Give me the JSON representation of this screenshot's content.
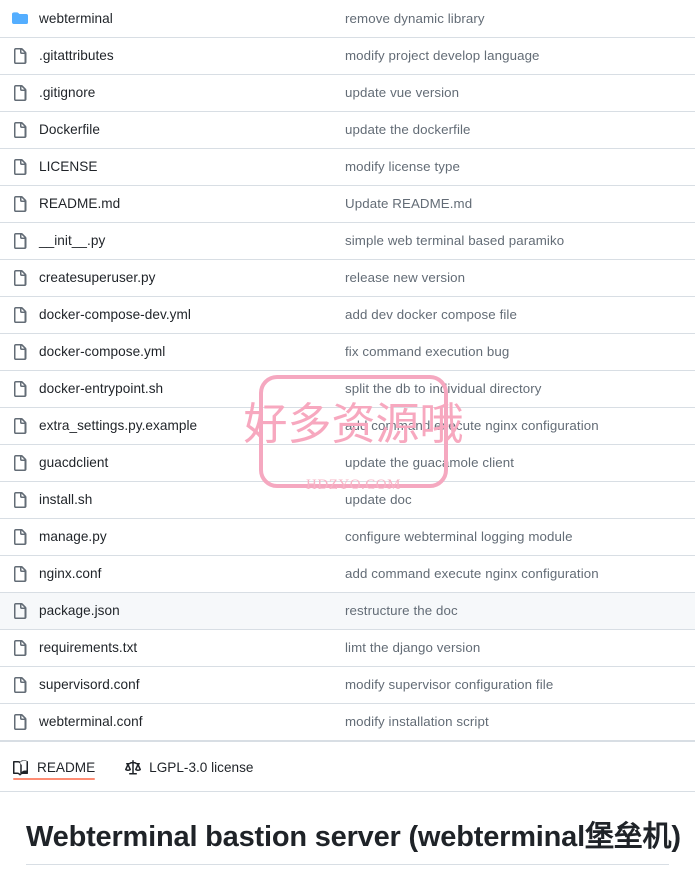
{
  "file_list": {
    "columns": [
      "name",
      "commit_message"
    ],
    "rows": [
      {
        "name": "webterminal",
        "icon": "folder-icon",
        "type": "folder",
        "commit_message": "remove dynamic library",
        "highlighted": false
      },
      {
        "name": ".gitattributes",
        "icon": "file-icon",
        "type": "file",
        "commit_message": "modify project develop language",
        "highlighted": false
      },
      {
        "name": ".gitignore",
        "icon": "file-icon",
        "type": "file",
        "commit_message": "update vue version",
        "highlighted": false
      },
      {
        "name": "Dockerfile",
        "icon": "file-icon",
        "type": "file",
        "commit_message": "update the dockerfile",
        "highlighted": false
      },
      {
        "name": "LICENSE",
        "icon": "file-icon",
        "type": "file",
        "commit_message": "modify license type",
        "highlighted": false
      },
      {
        "name": "README.md",
        "icon": "file-icon",
        "type": "file",
        "commit_message": "Update README.md",
        "highlighted": false
      },
      {
        "name": "__init__.py",
        "icon": "file-icon",
        "type": "file",
        "commit_message": "simple web terminal based paramiko",
        "highlighted": false
      },
      {
        "name": "createsuperuser.py",
        "icon": "file-icon",
        "type": "file",
        "commit_message": "release new version",
        "highlighted": false
      },
      {
        "name": "docker-compose-dev.yml",
        "icon": "file-icon",
        "type": "file",
        "commit_message": "add dev docker compose file",
        "highlighted": false
      },
      {
        "name": "docker-compose.yml",
        "icon": "file-icon",
        "type": "file",
        "commit_message": "fix command execution bug",
        "highlighted": false
      },
      {
        "name": "docker-entrypoint.sh",
        "icon": "file-icon",
        "type": "file",
        "commit_message": "split the db to individual directory",
        "highlighted": false
      },
      {
        "name": "extra_settings.py.example",
        "icon": "file-icon",
        "type": "file",
        "commit_message": "add command execute nginx configuration",
        "highlighted": false
      },
      {
        "name": "guacdclient",
        "icon": "file-icon",
        "type": "file",
        "commit_message": "update the guacamole client",
        "highlighted": false
      },
      {
        "name": "install.sh",
        "icon": "file-icon",
        "type": "file",
        "commit_message": "update doc",
        "highlighted": false
      },
      {
        "name": "manage.py",
        "icon": "file-icon",
        "type": "file",
        "commit_message": "configure webterminal logging module",
        "highlighted": false
      },
      {
        "name": "nginx.conf",
        "icon": "file-icon",
        "type": "file",
        "commit_message": "add command execute nginx configuration",
        "highlighted": false
      },
      {
        "name": "package.json",
        "icon": "file-icon",
        "type": "file",
        "commit_message": "restructure the doc",
        "highlighted": true
      },
      {
        "name": "requirements.txt",
        "icon": "file-icon",
        "type": "file",
        "commit_message": "limt the django version",
        "highlighted": false
      },
      {
        "name": "supervisord.conf",
        "icon": "file-icon",
        "type": "file",
        "commit_message": "modify supervisor configuration file",
        "highlighted": false
      },
      {
        "name": "webterminal.conf",
        "icon": "file-icon",
        "type": "file",
        "commit_message": "modify installation script",
        "highlighted": false
      }
    ]
  },
  "readme_tabs": {
    "items": [
      {
        "label": "README",
        "icon": "book-icon",
        "active": true
      },
      {
        "label": "LGPL-3.0 license",
        "icon": "scales-icon",
        "active": false
      }
    ]
  },
  "readme": {
    "heading": "Webterminal bastion server (webterminal堡垒机)"
  },
  "watermark": {
    "text": "好多资源哦",
    "domain": "HDZYO.COM"
  },
  "colors": {
    "folder_icon": "#54aeff",
    "file_icon": "#636c76",
    "row_border": "#d8dee4",
    "row_highlight": "#f6f8fa",
    "active_tab_underline": "#fd8c73",
    "commit_text": "#636c76",
    "name_text": "#1f2328",
    "watermark_pink": "#f5a8c0"
  }
}
